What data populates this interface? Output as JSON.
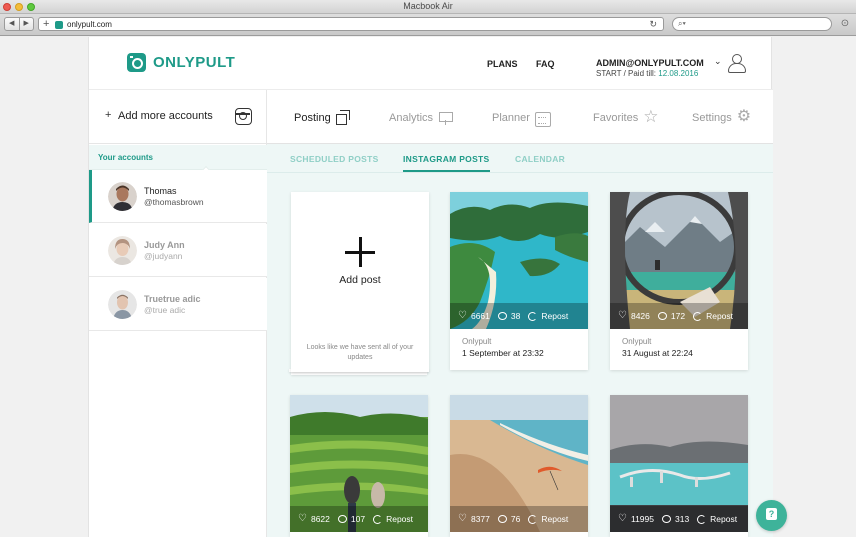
{
  "browser": {
    "window_title": "Macbook Air",
    "url": "onlypult.com"
  },
  "header": {
    "logo_text": "ONLYPULT",
    "nav": {
      "plans": "PLANS",
      "faq": "FAQ"
    },
    "admin_email": "ADMIN@ONLYPULT.COM",
    "plan_prefix": "START / Paid till:",
    "paid_till": "12.08.2016"
  },
  "sidebar": {
    "add_accounts_label": "Add more accounts",
    "your_accounts_label": "Your accounts",
    "accounts": [
      {
        "name": "Thomas",
        "handle": "@thomasbrown",
        "active": true
      },
      {
        "name": "Judy Ann",
        "handle": "@judyann",
        "active": false
      },
      {
        "name": "Truetrue adic",
        "handle": "@true adic",
        "active": false
      }
    ]
  },
  "main": {
    "tabs": [
      {
        "label": "Posting",
        "icon": "posting-icon",
        "active": true
      },
      {
        "label": "Analytics",
        "icon": "analytics-icon",
        "active": false
      },
      {
        "label": "Planner",
        "icon": "calendar-icon",
        "active": false
      },
      {
        "label": "Favorites",
        "icon": "star-icon",
        "active": false
      },
      {
        "label": "Settings",
        "icon": "gear-icon",
        "active": false
      }
    ],
    "subtabs": [
      {
        "label": "SCHEDULED POSTS",
        "active": false
      },
      {
        "label": "INSTAGRAM POSTS",
        "active": true
      },
      {
        "label": "CALENDAR",
        "active": false
      }
    ],
    "add_post": {
      "label": "Add post",
      "note": "Looks like we have sent all of your updates"
    },
    "repost_label": "Repost",
    "posts": [
      {
        "likes": "6661",
        "comments": "38",
        "author": "Onlypult",
        "date": "1 September at 23:32"
      },
      {
        "likes": "8426",
        "comments": "172",
        "author": "Onlypult",
        "date": "31 August at 22:24"
      },
      {
        "likes": "8622",
        "comments": "107"
      },
      {
        "likes": "8377",
        "comments": "76"
      },
      {
        "likes": "11995",
        "comments": "313"
      }
    ]
  },
  "colors": {
    "accent": "#1e9a88",
    "accent_light": "#8fcfc6",
    "main_bg": "#eef7f6",
    "help_button": "#3eb39a"
  }
}
